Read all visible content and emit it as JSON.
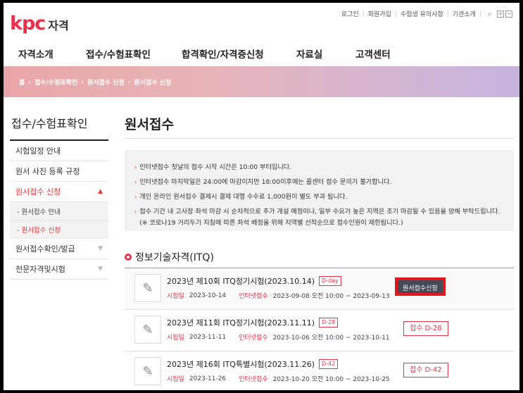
{
  "header": {
    "logo_main": "kpc",
    "logo_sub": "자격",
    "util_links": [
      "로그인",
      "회원가입",
      "수험생 유의사항",
      "기관소개"
    ],
    "util_icons": [
      "search-icon",
      "zoom-in-icon",
      "zoom-out-icon"
    ]
  },
  "gnb": [
    "자격소개",
    "접수/수험표확인",
    "합격확인/자격증신청",
    "자료실",
    "고객센터"
  ],
  "breadcrumb": [
    "홈",
    "접수/수험표확인",
    "원서접수 신청",
    "원서접수 신청"
  ],
  "lnb": {
    "title": "접수/수험표확인",
    "items": [
      {
        "label": "시험일정 안내"
      },
      {
        "label": "원서 사진 등록 규정"
      },
      {
        "label": "원서접수 신청"
      },
      {
        "label": "원서접수확인/발급"
      },
      {
        "label": "전문자격및시험"
      }
    ],
    "sub_items": [
      "- 원서접수 안내",
      "- 원서접수 신청"
    ]
  },
  "main": {
    "title": "원서접수",
    "notices": [
      "인터넷접수 첫날의 접수 시작 시간은 10:00 부터입니다.",
      "인터넷접수 마지막일은 24:00에 마감이지만 18:00이후에는 콜센터 접수 문의가 불가합니다.",
      "개인 온라인 원서접수 결제시 결제 대행 수수료 1,000원이 별도 부과 됩니다.",
      "접수 기간 내 고사장 좌석 마감 시 순차적으로 추가 개설 예정이나, 일부 수요가 높은 지역은 조기 마감될 수 있음을 양해 부탁드립니다.(※ 코로나19 거리두기 지침에 따른 좌석 배정을 위해 지역별 선착순으로 접수인원이 제한됩니다.)"
    ],
    "section_title": "정보기술자격(ITQ)",
    "exams": [
      {
        "name": "2023년 제10회 ITQ정기시험(2023.10.14)",
        "dday": "D-day",
        "exam_label": "시험일",
        "exam_date": "2023-10-14",
        "reg_label": "인터넷접수",
        "reg_period": "2023-09-08 오전 10:00 ~ 2023-09-13",
        "action": "원서접수신청"
      },
      {
        "name": "2023년 제11회 ITQ정기시험(2023.11.11)",
        "dday": "D-28",
        "exam_label": "시험일",
        "exam_date": "2023-11-11",
        "reg_label": "인터넷접수",
        "reg_period": "2023-10-06 오전 10:00 ~ 2023-10-11",
        "action": "접수 D-28"
      },
      {
        "name": "2023년 제16회 ITQ특별시험(2023.11.26)",
        "dday": "D-42",
        "exam_label": "시험일",
        "exam_date": "2023-11-26",
        "reg_label": "인터넷접수",
        "reg_period": "2023-10-20 오전 10:00 ~ 2023-10-25",
        "action": "접수 D-42"
      }
    ]
  }
}
